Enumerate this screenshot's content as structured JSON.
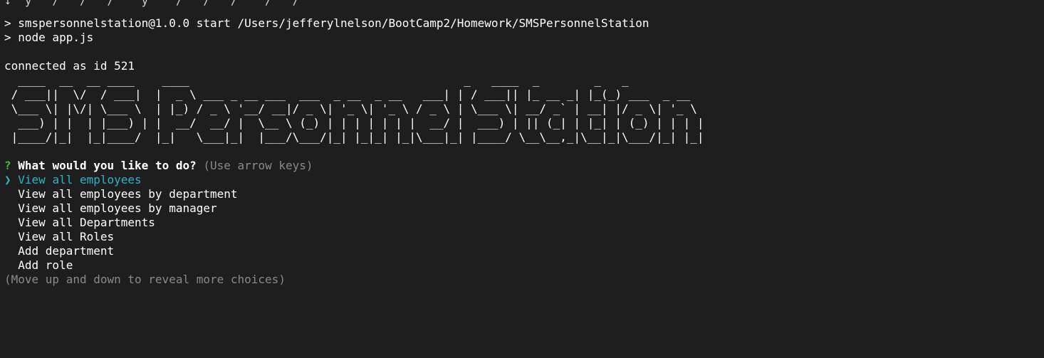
{
  "terminal": {
    "clipped_top_line": "↧  y   /   /   /    y    /   /   /    /   /",
    "npm_start": "> smspersonnelstation@1.0.0 start /Users/jefferylnelson/BootCamp2/Homework/SMSPersonnelStation",
    "node_cmd": "> node app.js",
    "connected": "connected as id 521",
    "banner_lines": [
      "  ____  __  __ ____    ____                                        _   ____  _        _   _",
      " / ___||  \\/  / ___|  |  _ \\ ___ _ __ ___  ___  _ __  _ __   ___| | / ___|| |_ __ _| |_(_) ___  _ __",
      " \\___ \\| |\\/| \\___ \\  | |_) / _ \\ '__/ __|/ _ \\| '_ \\| '_ \\ / _ \\ | \\___ \\| __/ _` | __| |/ _ \\| '_ \\",
      "  ___) | |  | |___) | |  __/  __/ |  \\__ \\ (_) | | | | | | |  __/ |  ___) | || (_| | |_| | (_) | | | |",
      " |____/|_|  |_|____/  |_|   \\___|_|  |___/\\___/|_| |_|_| |_|\\___|_| |____/ \\__\\__,_|\\__|_|\\___/|_| |_|"
    ],
    "prompt": {
      "marker": "?",
      "question": "What would you like to do?",
      "hint": "(Use arrow keys)"
    },
    "pointer": "❯",
    "choices": [
      "View all employees",
      "View all employees by department",
      "View all employees by manager",
      "View all Departments",
      "View all Roles",
      "Add department",
      "Add role"
    ],
    "selected_index": 0,
    "footer_hint": "(Move up and down to reveal more choices)"
  },
  "colors": {
    "background": "#1e1e1e",
    "text": "#ffffff",
    "prompt_marker": "#35c235",
    "selected": "#2cb5c9",
    "muted": "#8a8a8a"
  }
}
